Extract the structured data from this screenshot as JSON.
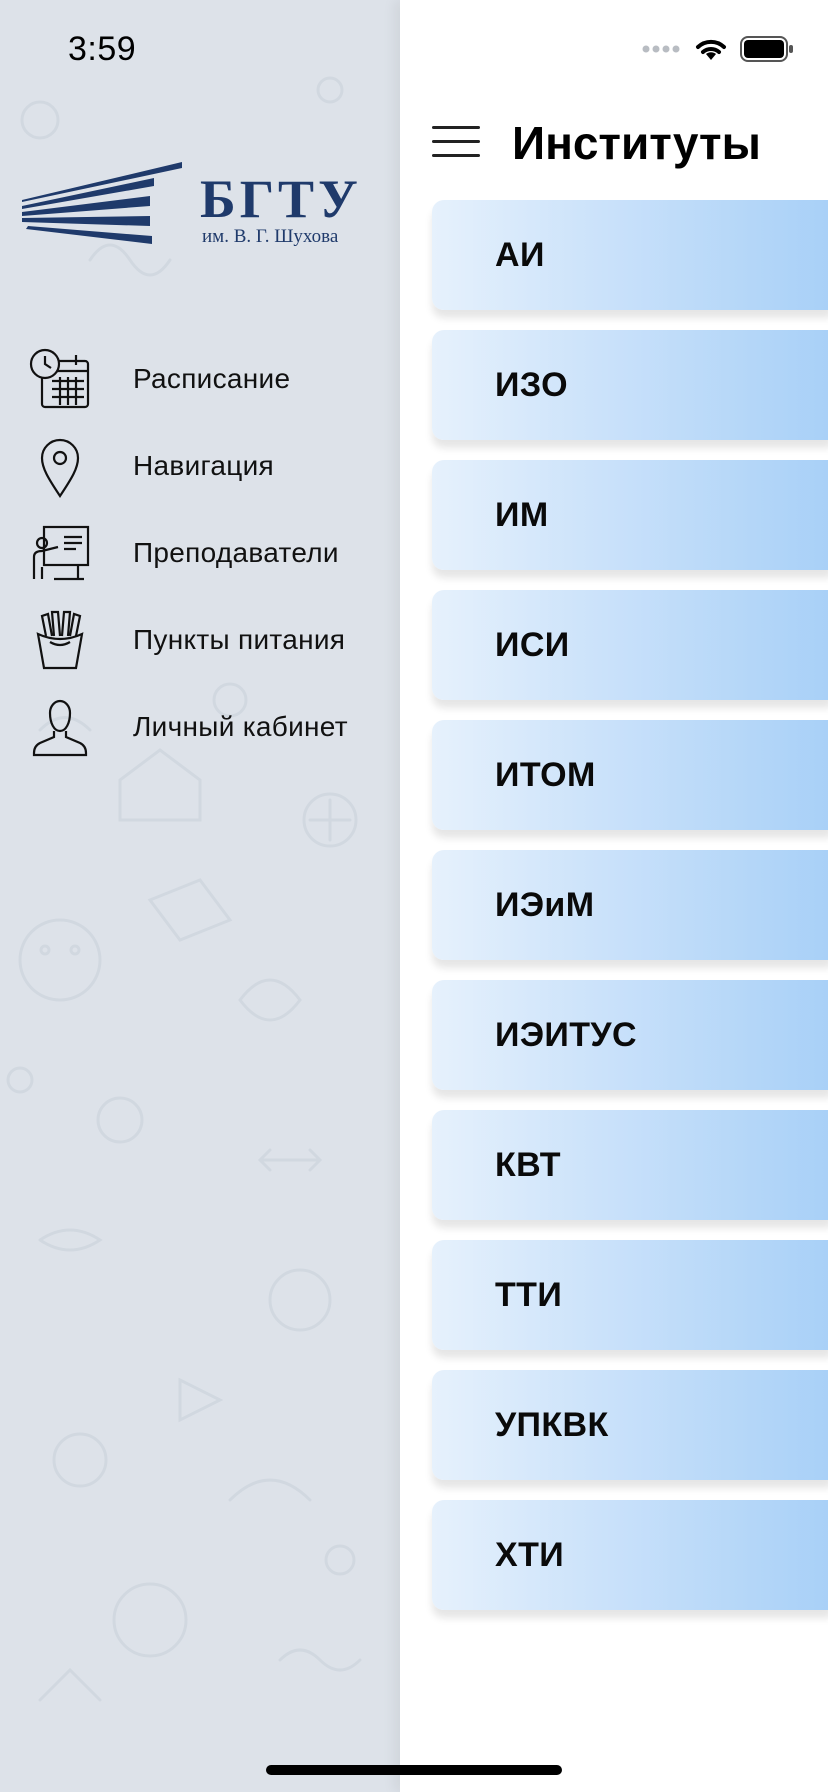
{
  "status_bar": {
    "time": "3:59"
  },
  "logo": {
    "title": "БГТУ",
    "subtitle": "им. В. Г. Шухова"
  },
  "drawer": {
    "items": [
      {
        "label": "Расписание",
        "icon": "schedule-calendar-clock-icon"
      },
      {
        "label": "Навигация",
        "icon": "map-pin-icon"
      },
      {
        "label": "Преподаватели",
        "icon": "teacher-board-icon"
      },
      {
        "label": "Пункты питания",
        "icon": "fries-icon"
      },
      {
        "label": "Личный кабинет",
        "icon": "user-icon"
      }
    ]
  },
  "header": {
    "title": "Институты"
  },
  "institutes": [
    {
      "label": "АИ"
    },
    {
      "label": "ИЗО"
    },
    {
      "label": "ИМ"
    },
    {
      "label": "ИСИ"
    },
    {
      "label": "ИТОМ"
    },
    {
      "label": "ИЭиМ"
    },
    {
      "label": "ИЭИТУС"
    },
    {
      "label": "КВТ"
    },
    {
      "label": "ТТИ"
    },
    {
      "label": "УПКВК"
    },
    {
      "label": "ХТИ"
    }
  ],
  "colors": {
    "drawer_bg": "#dde2e9",
    "brand": "#1f3a6b",
    "card_gradient_start": "#e6f1fc",
    "card_gradient_end": "#a8d0f7"
  }
}
